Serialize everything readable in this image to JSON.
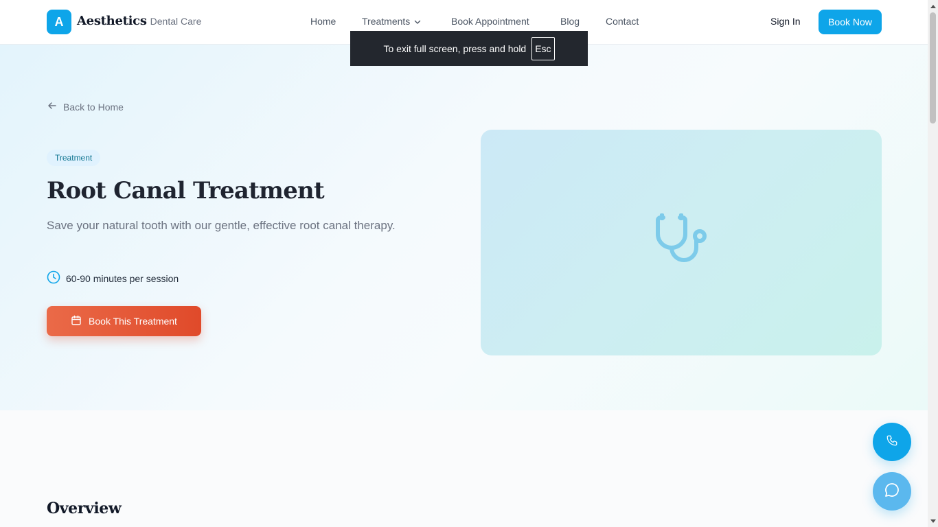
{
  "header": {
    "logo_letter": "A",
    "brand_name": "Aesthetics",
    "brand_sub": "Dental Care",
    "nav": [
      "Home",
      "Treatments",
      "Book Appointment",
      "Blog",
      "Contact"
    ],
    "sign_in": "Sign In",
    "book_now": "Book Now"
  },
  "fullscreen_notice": {
    "text": "To exit full screen, press and hold",
    "key": "Esc"
  },
  "hero": {
    "back_link": "Back to Home",
    "badge": "Treatment",
    "title": "Root Canal Treatment",
    "subtitle": "Save your natural tooth with our gentle, effective root canal therapy.",
    "duration": "60-90 minutes per session",
    "cta": "Book This Treatment",
    "image_icon": "stethoscope-icon"
  },
  "overview": {
    "heading": "Overview"
  },
  "floating": {
    "phone_icon": "phone-icon",
    "chat_icon": "chat-icon"
  },
  "colors": {
    "primary": "#0ea5e9",
    "cta_start": "#ea6a48",
    "cta_end": "#e04a2a",
    "badge_bg": "#e0f2fe",
    "badge_text": "#0e7490"
  }
}
